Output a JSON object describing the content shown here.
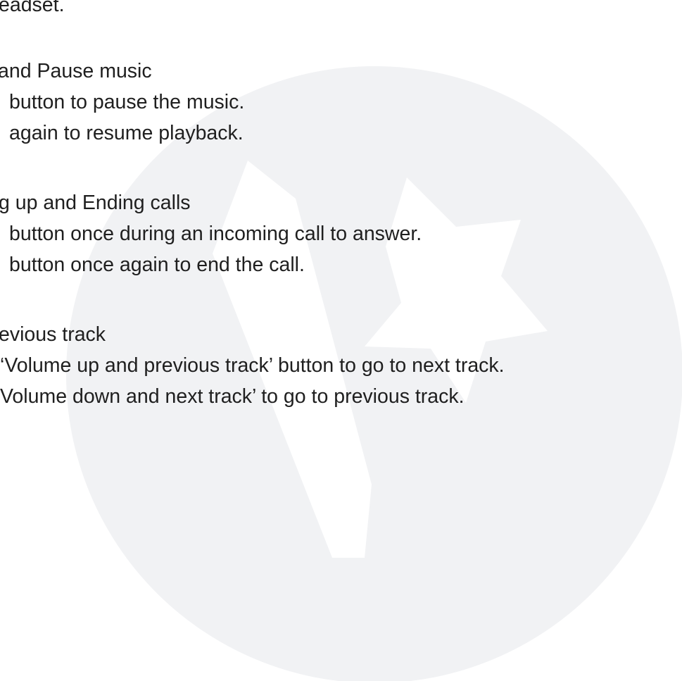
{
  "document": {
    "intro_tail": "eadset.",
    "sections": [
      {
        "heading": "and Pause music",
        "lines": [
          "button to pause the music.",
          "again to resume playback."
        ]
      },
      {
        "heading": "g up and Ending calls",
        "lines": [
          "button once during an incoming call to answer.",
          "button once again to end the call."
        ]
      },
      {
        "heading": "evious track",
        "lines": [
          "‘Volume up and previous track’ button to go to next track.",
          "Volume down and next track’ to go to previous track."
        ]
      }
    ]
  },
  "watermark": {
    "icon": "star-logo-icon",
    "circle_color": "#f1f2f4",
    "mark_color": "#ffffff"
  }
}
